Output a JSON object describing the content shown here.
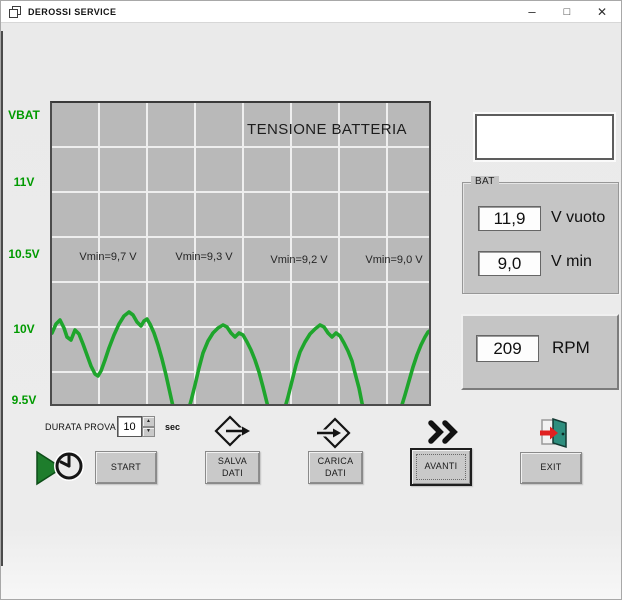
{
  "window": {
    "title": "DEROSSI SERVICE",
    "minimize_glyph": "–",
    "maximize_glyph": "□",
    "close_glyph": "✕"
  },
  "chart": {
    "title": "TENSIONE BATTERIA",
    "y_axis_labels": [
      "VBAT",
      "11V",
      "10.5V",
      "10V",
      "9.5V"
    ],
    "annotations": [
      "Vmin=9,7 V",
      "Vmin=9,3 V",
      "Vmin=9,2 V",
      "Vmin=9,0 V"
    ],
    "line_color": "#1ea52c",
    "waveform_points": "0,230 4,221 8,217 12,225 15,234 19,237 23,227 27,231 31,241 35,252 39,263 43,271 46,273 49,268 53,257 57,245 62,232 67,221 72,213 77,209 81,212 85,219 89,223 92,218 95,216 98,221 102,230 106,242 110,256 114,272 118,290 122,308 126,318 131,321 135,312 139,298 143,282 147,265 151,250 156,238 161,230 166,225 171,222 175,224 179,230 183,234 187,230 191,232 195,239 199,247 203,257 207,269 211,284 215,300 218,312 223,320 228,318 232,308 236,294 240,278 244,262 248,249 253,239 258,231 263,226 268,222 272,224 276,230 280,234 284,230 288,233 292,240 296,248 300,258 303,270 307,285 310,300 313,312 318,320 323,321 329,322 335,322 340,319 344,314 349,305 353,292 357,278 361,264 365,252 369,242 373,234 376,229 381,226"
  },
  "chart_data": {
    "type": "line",
    "title": "TENSIONE BATTERIA",
    "ylabel": "VBAT",
    "y_ticks": [
      "9.5V",
      "10V",
      "10.5V",
      "11V",
      "VBAT"
    ],
    "grid": true,
    "series": [
      {
        "name": "tensione batteria",
        "description": "periodic cranking-voltage oscillation, ~4 cycles visible; peaks ~10.1 V, dips clipped below 9.5 V axis",
        "vmin_per_cycle_V": [
          9.7,
          9.3,
          9.2,
          9.0
        ]
      }
    ]
  },
  "right_panel": {
    "display_box_value": "",
    "bat": {
      "legend": "BAT",
      "v_vuoto_value": "11,9",
      "v_vuoto_label": "V vuoto",
      "v_min_value": "9,0",
      "v_min_label": "V min"
    },
    "rpm": {
      "value": "209",
      "label": "RPM"
    }
  },
  "controls": {
    "durata_prova_label": "DURATA PROVA",
    "durata_value": "10",
    "durata_unit": "sec",
    "spin_up_glyph": "▲",
    "spin_down_glyph": "▼",
    "start_label": "START",
    "salva_label": "SALVA\nDATI",
    "carica_label": "CARICA\nDATI",
    "avanti_label": "AVANTI",
    "exit_label": "EXIT"
  }
}
